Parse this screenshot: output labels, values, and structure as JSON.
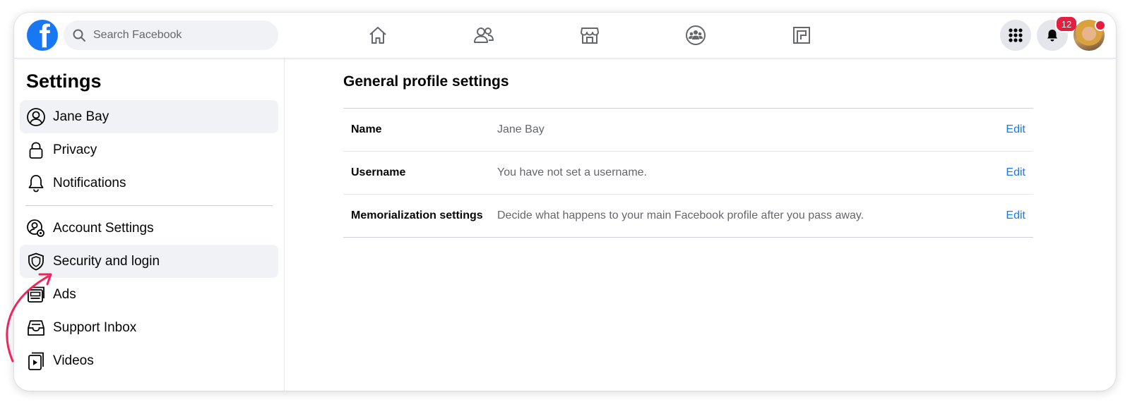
{
  "search": {
    "placeholder": "Search Facebook"
  },
  "nav": {
    "icons": [
      "home-icon",
      "friends-icon",
      "marketplace-icon",
      "groups-icon",
      "gaming-icon"
    ]
  },
  "header": {
    "notifications_count": "12",
    "colors": {
      "brand": "#1877f2",
      "badge": "#e41e3f"
    }
  },
  "sidebar": {
    "title": "Settings",
    "items": [
      {
        "label": "Jane Bay",
        "icon": "user-circle-icon",
        "active": true
      },
      {
        "label": "Privacy",
        "icon": "lock-icon"
      },
      {
        "label": "Notifications",
        "icon": "bell-icon"
      },
      {
        "label": "Account Settings",
        "icon": "user-gear-icon"
      },
      {
        "label": "Security and login",
        "icon": "shield-icon",
        "active": true
      },
      {
        "label": "Ads",
        "icon": "ads-icon"
      },
      {
        "label": "Support Inbox",
        "icon": "inbox-icon"
      },
      {
        "label": "Videos",
        "icon": "video-icon"
      }
    ]
  },
  "main": {
    "title": "General profile settings",
    "rows": [
      {
        "label": "Name",
        "value": "Jane Bay",
        "action": "Edit"
      },
      {
        "label": "Username",
        "value": "You have not set a username.",
        "action": "Edit"
      },
      {
        "label": "Memorialization settings",
        "value": "Decide what happens to your main Facebook profile after you pass away.",
        "action": "Edit"
      }
    ]
  },
  "annotation": {
    "color": "#f0245a",
    "points_to": "Security and login"
  }
}
